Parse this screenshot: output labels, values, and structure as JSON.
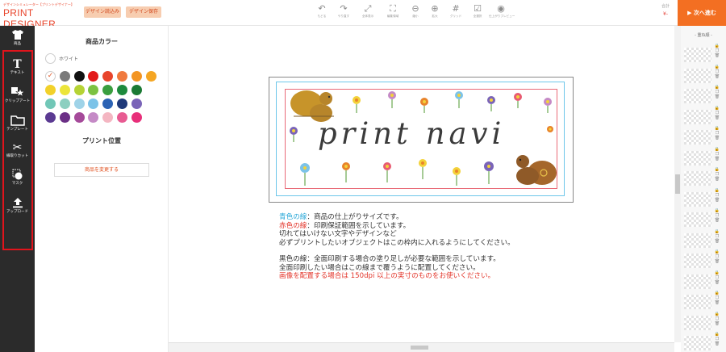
{
  "app": {
    "logo_sub": "デザインシミュレーター【プリントデザイナー】",
    "logo_main": "PRINT DESIGNER",
    "load_button": "デザイン読込み",
    "save_button": "デザイン保存",
    "total_label": "合計",
    "total_price": "¥-",
    "next_button": "▶ 次へ進む"
  },
  "toolbar": [
    {
      "icon": "undo-icon",
      "glyph": "↶",
      "label": "もどる"
    },
    {
      "icon": "redo-icon",
      "glyph": "↷",
      "label": "やり直す"
    },
    {
      "icon": "fit-screen-icon",
      "glyph": "⤢",
      "label": "全体表示"
    },
    {
      "icon": "edit-area-icon",
      "glyph": "⛶",
      "label": "編集領域"
    },
    {
      "icon": "zoom-out-icon",
      "glyph": "⊖",
      "label": "縮小"
    },
    {
      "icon": "zoom-in-icon",
      "glyph": "⊕",
      "label": "拡大"
    },
    {
      "icon": "grid-icon",
      "glyph": "#",
      "label": "グリッド"
    },
    {
      "icon": "select-all-icon",
      "glyph": "☑",
      "label": "全選択"
    },
    {
      "icon": "preview-icon",
      "glyph": "◉",
      "label": "仕上がりプレビュー"
    }
  ],
  "sidebar": [
    {
      "icon": "tshirt-icon",
      "glyph": "👕",
      "label": "商品"
    },
    {
      "icon": "text-icon",
      "glyph": "T",
      "label": "テキスト"
    },
    {
      "icon": "clipart-icon",
      "glyph": "★",
      "label": "クリップアート"
    },
    {
      "icon": "folder-icon",
      "glyph": "▭",
      "label": "テンプレート"
    },
    {
      "icon": "scissors-icon",
      "glyph": "✂",
      "label": "線取りカット"
    },
    {
      "icon": "mask-icon",
      "glyph": "◐",
      "label": "マスク"
    },
    {
      "icon": "upload-icon",
      "glyph": "⇧",
      "label": "アップロード"
    }
  ],
  "colors_panel": {
    "title": "商品カラー",
    "selected_label": "ホワイト",
    "swatches": [
      "#7a7a7a",
      "#111111",
      "#e21a1a",
      "#e8452c",
      "#f07a3e",
      "#f39523",
      "#f5a623",
      "#f2d12a",
      "#ece53a",
      "#b5d335",
      "#7cc242",
      "#3a9e3f",
      "#1e8a3d",
      "#1b7a34",
      "#72c7b7",
      "#8ccfc0",
      "#9fd3e8",
      "#7cc3e8",
      "#2c63b4",
      "#1f3a7a",
      "#7a64b8",
      "#5b3a92",
      "#6b2f86",
      "#a54a9a",
      "#c58ac6",
      "#f4b6c2",
      "#e85b92",
      "#e82f7a"
    ],
    "print_position_title": "プリント位置",
    "change_product_button": "商品を変更する"
  },
  "stage": {
    "design_text": "print navi"
  },
  "notes": {
    "line1_highlight": "青色の線",
    "line1_rest": "：商品の仕上がりサイズです。",
    "line2_highlight": "赤色の線",
    "line2_rest": "：印刷保証範囲を示しています。",
    "line3": "切れてはいけない文字やデザインなど",
    "line4": "必ずプリントしたいオブジェクトはこの枠内に入れるようにしてください。",
    "line5": "黒色の線：全面印刷する場合の塗り足しが必要な範囲を示しています。",
    "line6": "全面印刷したい場合はこの線まで覆うように配置してください。",
    "line7": "画像を配置する場合は 150dpi 以上の実寸のものをお使いください。"
  },
  "right_panel": {
    "title": "- 重ね順 -"
  },
  "colors": {
    "accent": "#f36f22",
    "highlight_red": "#e0141c"
  }
}
